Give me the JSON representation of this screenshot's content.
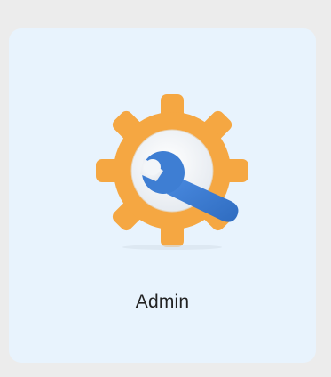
{
  "tile": {
    "label": "Admin",
    "icon": "admin-gear-wrench-icon"
  },
  "colors": {
    "page_background": "#ececec",
    "tile_background": "#e8f3fd",
    "gear_orange": "#f5a742",
    "gear_inner": "#ffffff",
    "wrench_blue": "#3e7ed3",
    "label_text": "#222222"
  }
}
